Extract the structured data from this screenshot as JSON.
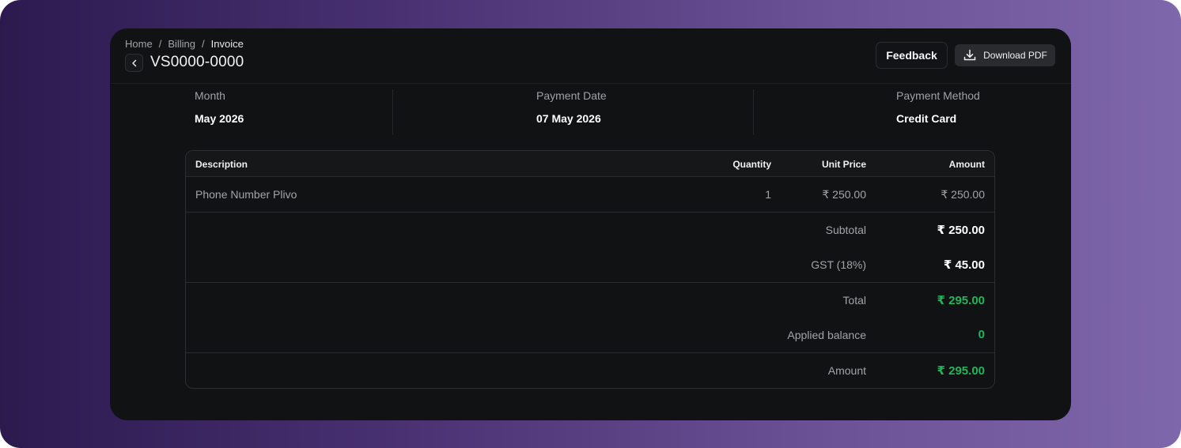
{
  "breadcrumb": {
    "home": "Home",
    "billing": "Billing",
    "invoice": "Invoice",
    "separator": "/"
  },
  "title": "VS0000-0000",
  "actions": {
    "feedback": "Feedback",
    "download_pdf": "Download PDF"
  },
  "meta": {
    "month_label": "Month",
    "month_value": "May 2026",
    "payment_date_label": "Payment Date",
    "payment_date_value": "07 May 2026",
    "payment_method_label": "Payment Method",
    "payment_method_value": "Credit Card"
  },
  "table": {
    "headers": {
      "description": "Description",
      "quantity": "Quantity",
      "unit_price": "Unit Price",
      "amount": "Amount"
    },
    "rows": [
      {
        "description": "Phone Number Plivo",
        "quantity": "1",
        "unit_price": "₹ 250.00",
        "amount": "₹ 250.00"
      }
    ]
  },
  "summary": {
    "subtotal_label": "Subtotal",
    "subtotal_value": "₹ 250.00",
    "gst_label": "GST (18%)",
    "gst_value": "₹ 45.00",
    "total_label": "Total",
    "total_value": "₹ 295.00",
    "applied_balance_label": "Applied balance",
    "applied_balance_value": "0",
    "amount_label": "Amount",
    "amount_value": "₹ 295.00"
  },
  "colors": {
    "accent_green": "#22b55a",
    "card_bg": "#111214"
  },
  "icons": {
    "back": "chevron-left-icon",
    "download": "download-icon"
  }
}
